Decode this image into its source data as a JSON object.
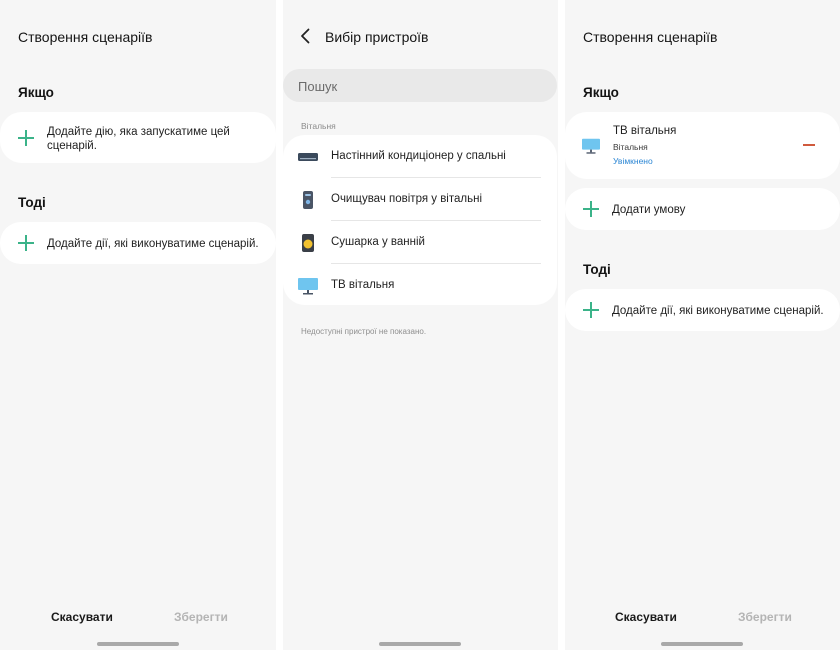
{
  "screen1": {
    "title": "Створення сценаріїв",
    "if_heading": "Якщо",
    "if_card_text": "Додайте дію, яка запускатиме цей сценарій.",
    "then_heading": "Тоді",
    "then_card_text": "Додайте дії, які виконуватиме сценарій.",
    "cancel_label": "Скасувати",
    "save_label": "Зберегти"
  },
  "screen2": {
    "title": "Вибір пристроїв",
    "search_placeholder": "Пошук",
    "group_label": "Вітальня",
    "devices": [
      {
        "name": "Настінний кондиціонер у спальні",
        "icon": "air-conditioner-icon"
      },
      {
        "name": "Очищувач повітря у вітальні",
        "icon": "air-purifier-icon"
      },
      {
        "name": "Сушарка у ванній",
        "icon": "dryer-icon"
      },
      {
        "name": "ТВ  вітальня",
        "icon": "tv-icon"
      }
    ],
    "note": "Недоступні пристрої не показано."
  },
  "screen3": {
    "title": "Створення сценаріїв",
    "if_heading": "Якщо",
    "device_name": "ТВ  вітальня",
    "device_room": "Вітальня",
    "device_state": "Увімкнено",
    "add_condition_label": "Додати умову",
    "then_heading": "Тоді",
    "then_card_text": "Додайте дії, які виконуватиме сценарій.",
    "cancel_label": "Скасувати",
    "save_label": "Зберегти"
  },
  "colors": {
    "accent_green": "#3bb389",
    "remove_red": "#d05a3d",
    "state_blue": "#2d87d4",
    "background": "#f6f6f6"
  }
}
